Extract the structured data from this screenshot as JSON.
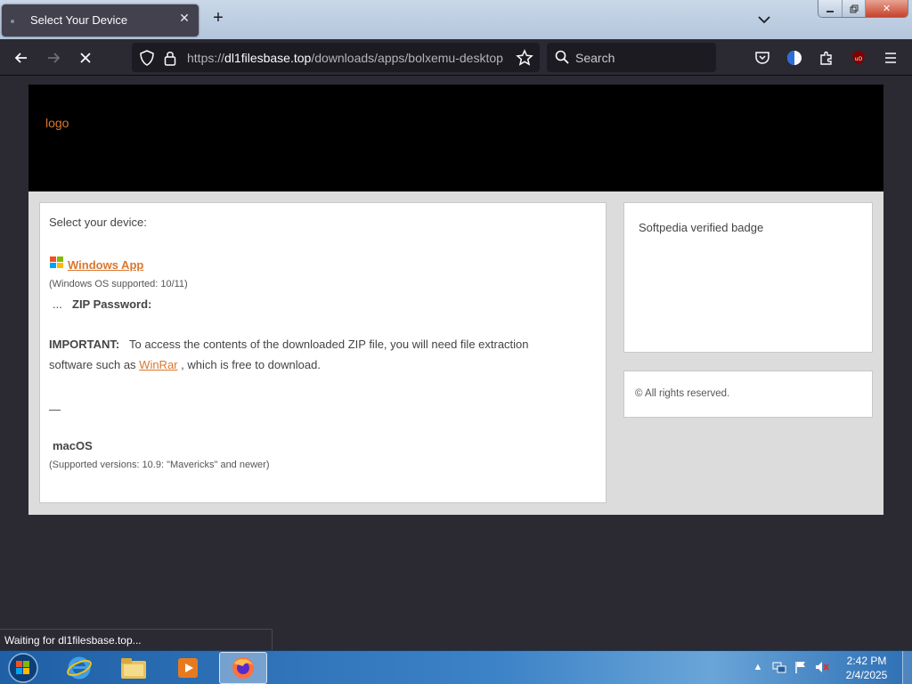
{
  "browser": {
    "tab": {
      "title": "Select Your Device"
    },
    "url": {
      "scheme": "https://",
      "host": "dl1filesbase.top",
      "path": "/downloads/apps/bolxemu-desktop"
    },
    "search": {
      "placeholder": "Search"
    },
    "window_buttons": {
      "minimize": "—",
      "maximize": "▢",
      "close": "✕"
    }
  },
  "site": {
    "logo": "logo",
    "main": {
      "prompt": "Select your device:",
      "windows_link": "Windows App",
      "windows_support": "(Windows OS supported: 10/11)",
      "zip_prefix": "...",
      "zip_label": "ZIP Password:",
      "important_label": "IMPORTANT:",
      "important_text": "To access the contents of the downloaded ZIP file, you will need file extraction",
      "important_text2_prefix": "software such as",
      "winrar_link": "WinRar",
      "important_text2_suffix": ", which is free to download.",
      "separator": "—",
      "macos_label": "macOS",
      "macos_support": "(Supported versions: 10.9: \"Mavericks\" and newer)"
    },
    "sidebar": {
      "badge": "Softpedia verified badge",
      "copyright": "© All rights reserved."
    }
  },
  "status_bar": {
    "text": "Waiting for dl1filesbase.top..."
  },
  "taskbar": {
    "clock": {
      "time": "2:42 PM",
      "date": "2/4/2025"
    }
  },
  "colors": {
    "accent": "#d9772f",
    "browser_chrome": "#2b2a33",
    "header": "#000000"
  }
}
